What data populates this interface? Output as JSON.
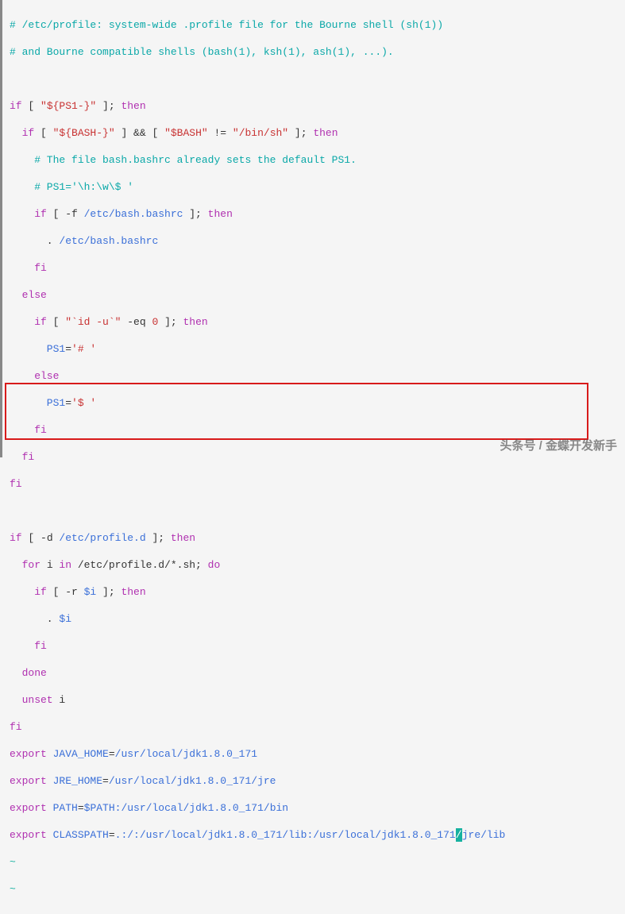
{
  "lines": {
    "l1a": "# /etc/profile:",
    "l1b": " system-wide .profile file ",
    "l1c": "for",
    "l1d": " the Bourne shell (sh(",
    "l1e": "1",
    "l1f": "))",
    "l2a": "# and Bourne compatible shells (bash(",
    "l2b": "1",
    "l2c": "), ksh(",
    "l2d": "1",
    "l2e": "), ash(",
    "l2f": "1",
    "l2g": "), ...).",
    "l4a": "if",
    "l4b": " [ ",
    "l4c": "\"${PS1-}\"",
    "l4d": " ]; ",
    "l4e": "then",
    "l5a": "  if",
    "l5b": " [ ",
    "l5c": "\"${BASH-}\"",
    "l5d": " ] && [ ",
    "l5e": "\"$BASH\"",
    "l5f": " != ",
    "l5g": "\"/bin/sh\"",
    "l5h": " ]; ",
    "l5i": "then",
    "l6a": "    # The file bash.bashrc already sets the default PS1.",
    "l7a": "    # PS1='\\h:\\w\\$ '",
    "l8a": "    if",
    "l8b": " [ -f ",
    "l8c": "/etc/bash.bashrc",
    "l8d": " ]; ",
    "l8e": "then",
    "l9a": "      . ",
    "l9b": "/etc/bash.bashrc",
    "l10a": "    fi",
    "l11a": "  else",
    "l12a": "    if",
    "l12b": " [ ",
    "l12c": "\"`id -u`\"",
    "l12d": " -eq ",
    "l12e": "0",
    "l12f": " ]; ",
    "l12g": "then",
    "l13a": "      PS1",
    "l13b": "=",
    "l13c": "'# '",
    "l14a": "    else",
    "l15a": "      PS1",
    "l15b": "=",
    "l15c": "'$ '",
    "l16a": "    fi",
    "l17a": "  fi",
    "l18a": "fi",
    "l20a": "if",
    "l20b": " [ -d ",
    "l20c": "/etc/profile.d",
    "l20d": " ]; ",
    "l20e": "then",
    "l21a": "  for",
    "l21b": " i ",
    "l21c": "in",
    "l21d": " /etc/profile.d/*.sh; ",
    "l21e": "do",
    "l22a": "    if",
    "l22b": " [ -r ",
    "l22c": "$i",
    "l22d": " ]; ",
    "l22e": "then",
    "l23a": "      . ",
    "l23b": "$i",
    "l24a": "    fi",
    "l25a": "  done",
    "l26a": "  unset",
    "l26b": " i",
    "l27a": "fi",
    "l28a": "export",
    "l28b": " JAVA_HOME",
    "l28c": "=",
    "l28d": "/usr/local/jdk1.8.0_171",
    "l29a": "export",
    "l29b": " JRE_HOME",
    "l29c": "=",
    "l29d": "/usr/local/jdk1.8.0_171/jre",
    "l30a": "export",
    "l30b": " PATH",
    "l30c": "=",
    "l30d": "$PATH",
    "l30e": ":/usr/local/jdk1.8.0_171/bin",
    "l31a": "export",
    "l31b": " CLASSPATH",
    "l31c": "=",
    "l31d": ".:/:/usr/local/jdk1.8.0_171/lib:/usr/local/jdk1.8.0_171",
    "l31e": "/",
    "l31f": "jre/lib",
    "tilde": "~"
  },
  "watermark": "头条号 / 金蝶开发新手"
}
